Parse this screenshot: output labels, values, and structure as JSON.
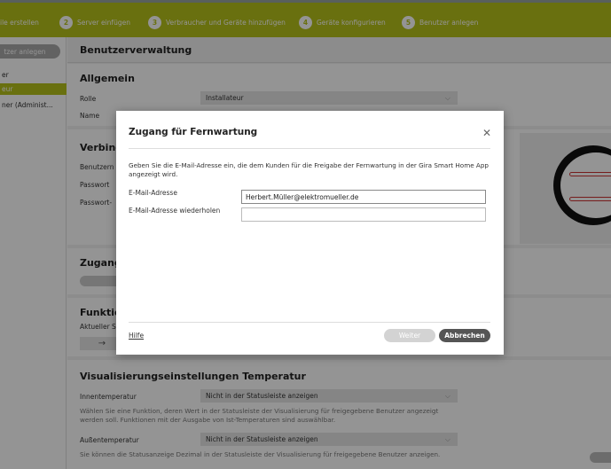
{
  "wizard": {
    "steps": [
      {
        "num": "",
        "label": "ile erstellen"
      },
      {
        "num": "2",
        "label": "Server einfügen"
      },
      {
        "num": "3",
        "label": "Verbraucher und Geräte hinzufügen"
      },
      {
        "num": "4",
        "label": "Geräte konfigurieren"
      },
      {
        "num": "5",
        "label": "Benutzer anlegen"
      }
    ]
  },
  "sidebar": {
    "add_button": "tzer anlegen",
    "items": [
      "er",
      "eur",
      "ner (Administ..."
    ]
  },
  "main": {
    "title": "Benutzerverwaltung",
    "allgemein": {
      "heading": "Allgemein",
      "rolle_label": "Rolle",
      "rolle_value": "Installateur",
      "name_label": "Name"
    },
    "verbindung": {
      "heading": "Verbind",
      "benutzer_label": "Benutzern",
      "passwort_label": "Passwort",
      "passwort2_label": "Passwort-"
    },
    "zugang": {
      "heading": "Zugang"
    },
    "funktionen": {
      "heading": "Funktio",
      "aktueller_label": "Aktueller S",
      "arrow": "→"
    },
    "visualisierung": {
      "heading": "Visualisierungseinstellungen Temperatur",
      "innen_label": "Innentemperatur",
      "innen_value": "Nicht in der Statusleiste anzeigen",
      "innen_help": "Wählen Sie eine Funktion, deren Wert in der Statusleiste der Visualisierung für freigegebene Benutzer angezeigt werden soll. Funktionen mit der Ausgabe von Ist-Temperaturen sind auswählbar.",
      "aussen_label": "Außentemperatur",
      "aussen_value": "Nicht in der Statusleiste anzeigen",
      "aussen_help": "Sie können die Statusanzeige Dezimal in der Statusleiste der Visualisierung für freigegebene Benutzer anzeigen."
    }
  },
  "modal": {
    "title": "Zugang für Fernwartung",
    "close": "✕",
    "description": "Geben Sie die E-Mail-Adresse ein, die dem Kunden für die Freigabe der Fernwartung in der Gira Smart Home App angezeigt wird.",
    "email_label": "E-Mail-Adresse",
    "email_value": "Herbert.Müller@elektromueller.de",
    "email_repeat_label": "E-Mail-Adresse wiederholen",
    "email_repeat_value": "",
    "help_link": "Hilfe",
    "next_button": "Weiter",
    "cancel_button": "Abbrechen"
  },
  "colors": {
    "accent": "#b5c11a",
    "overlay": "rgba(0,0,0,0.42)",
    "cancel_button": "#555555"
  }
}
